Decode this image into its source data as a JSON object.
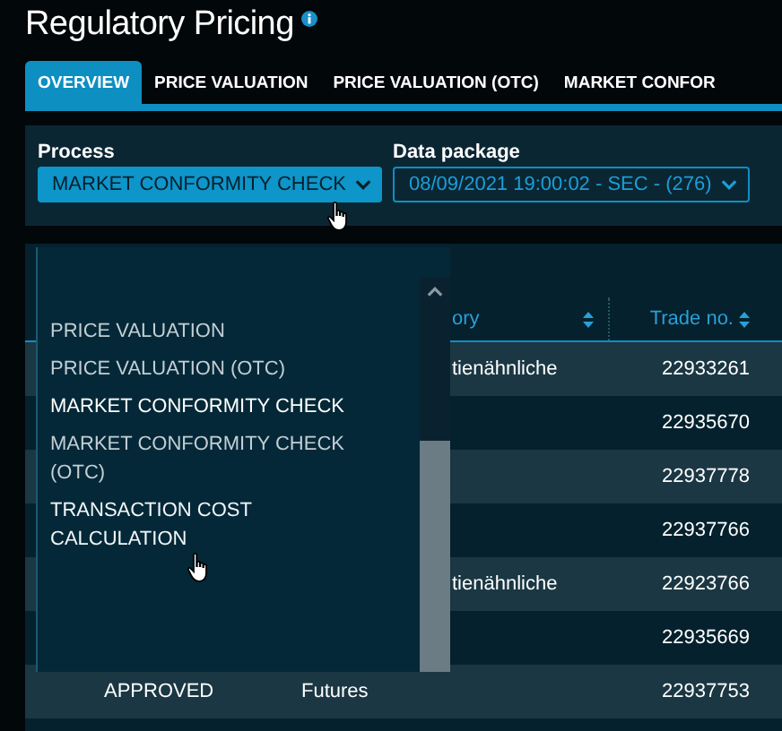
{
  "title": "Regulatory Pricing",
  "tabs": [
    {
      "label": "OVERVIEW",
      "selected": true
    },
    {
      "label": "PRICE VALUATION",
      "selected": false
    },
    {
      "label": "PRICE VALUATION (OTC)",
      "selected": false
    },
    {
      "label": "MARKET CONFOR",
      "selected": false
    }
  ],
  "filters": {
    "process": {
      "label": "Process",
      "value": "MARKET CONFORMITY CHECK"
    },
    "data_package": {
      "label": "Data package",
      "value": "08/09/2021 19:00:02 - SEC - (276)"
    }
  },
  "table": {
    "columns": [
      {
        "label": "ory"
      },
      {
        "label": "Trade no."
      }
    ],
    "rows": [
      {
        "category": "tienähnliche",
        "trade_no": "22933261"
      },
      {
        "trade_no": "22935670"
      },
      {
        "trade_no": "22937778"
      },
      {
        "trade_no": "22937766"
      },
      {
        "category": "tienähnliche",
        "trade_no": "22923766"
      },
      {
        "trade_no": "22935669"
      },
      {
        "status": "APPROVED",
        "type": "Futures",
        "trade_no": "22937753"
      }
    ]
  },
  "dropdown": {
    "options": [
      {
        "label": "PRICE VALUATION",
        "selected": false,
        "hovered": false
      },
      {
        "label": "PRICE VALUATION (OTC)",
        "selected": false,
        "hovered": false
      },
      {
        "label": "MARKET CONFORMITY CHECK",
        "selected": true,
        "hovered": false
      },
      {
        "label": "MARKET CONFORMITY CHECK (OTC)",
        "selected": false,
        "hovered": false
      },
      {
        "label": "TRANSACTION COST CALCULATION",
        "selected": false,
        "hovered": true
      }
    ]
  }
}
